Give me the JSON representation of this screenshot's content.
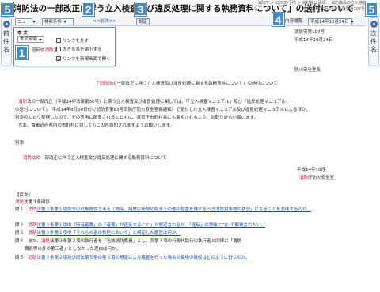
{
  "law_title": "消防法の一部改正に伴う立入検査及び違反処理に関する執務資料について」の送付について",
  "breadcrumb": "消防庁 > 公示文/予防 > 資料提出事項... 消防職員の立入検査",
  "date_line": "(平成14年10月24日消防安第107号)",
  "badges": [
    "1",
    "2",
    "3",
    "4",
    "5",
    "5"
  ],
  "left_nav": {
    "label": "前件名"
  },
  "right_nav": {
    "label": "次件名"
  },
  "toolbar": {
    "select_label": "ニュー",
    "search_select": "検索条件",
    "prev_label": "<<前",
    "next_label": "次>>",
    "gear_label": "設定",
    "jump_label": "内容閲覧:",
    "jump_select": "平成14年10月24日"
  },
  "popup": {
    "header": "本 文",
    "select": "本文部編",
    "opt1": "リンクを外す",
    "opt2": "大きな表を縮小する",
    "opt3": "リンクを新規画面で開く",
    "snip_prefix": "道府県",
    "snip_red": "消防",
    "snip_suffix": "主"
  },
  "doc": {
    "ref_no": "消防安第107号",
    "ref_date": "平成14年10月24日",
    "sender": "防火安全室長",
    "subject_red": "消防法",
    "subject_rest": "の一部改正に伴う立入検査及び違反処理に関する執務資料について」の送付について",
    "para1_a": "消防",
    "para1_b": "法の一部改正（平成14年法律第30号）に係う立入検査及び違反処理に関しては、「「立入検査マニュアル」及び「違反処理マニュアル」",
    "para2": "の送付について」（平成14年8月30日付け消防安第83号消防庁防火安全室長通知）で配付した立入検査マニュアル及び違反処理マニュアルによるほか、",
    "para3": "別添のとおり整理したので、その活用に配意されるとともに、貴管下市町村長にも周知されるよう、お取り計らい願います。",
    "para4": "なお、貴都道府県内の市町村に対してもこの旨周知されますようお願いします。",
    "appendix": "別添",
    "appendix_title_red": "消防法",
    "appendix_title_rest": "の一部改正に伴う立入検査及び違反処理に関する執務資料について",
    "sig_date": "平成14年10月",
    "sig_org_red": "消防",
    "sig_org_rest": "庁防火安全室",
    "toc": "【目次】",
    "q_header_red": "消防",
    "q_header_rest": "法第３条関係",
    "q1_label": "問１",
    "q1_red": "消防",
    "q1_blue": "法第３条第１項命令の対象物件である「物品、諸材の新設の除去その他の措置を講ずるべき消防対象物の状況」になることを意味するのか。",
    "q2_label": "問２",
    "q2_blue": "法第３条第１項中「所有者等」の「者等」が違反すること」が想定されるが、「違反」の意味について解説されたい。",
    "q3_label": "問３",
    "q3_blue": "法第３条第１項中「それらの者の負担において」と規定した趣旨は何か。",
    "q4_label": "問４",
    "q4_a": "また、",
    "q4_blue": "消防",
    "q4_b": "法第３条第２項の執行者を「当該消防職員」とし、同第４項の行政代執行の執行者と同様に「消防",
    "q4_c": "職員等以外の第三者」としなかった理由は何か。",
    "q5_label": "問５",
    "q5_blue": "法第３条第２項及び同法第５条の第３項の規定による措置を行った場合の費用の徴収はどのように行うのか。"
  }
}
